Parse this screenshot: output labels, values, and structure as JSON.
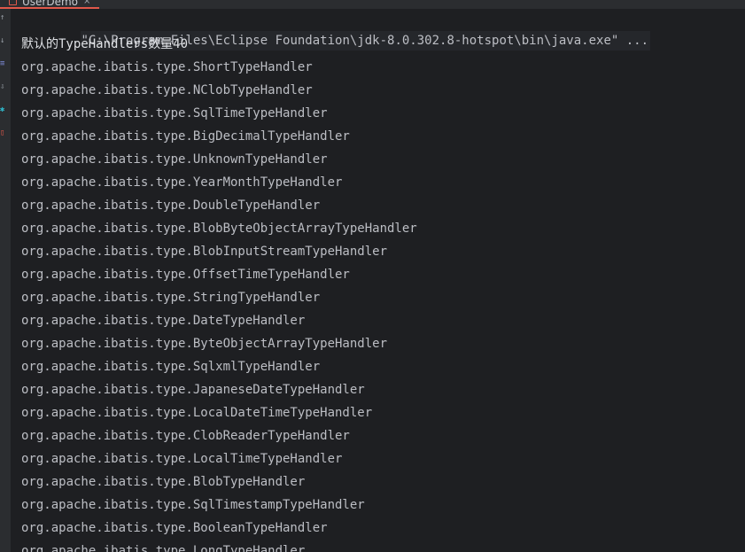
{
  "tab": {
    "label": "UserDemo",
    "close": "×",
    "accent": "#e0584a"
  },
  "gutter": {
    "icons": [
      {
        "name": "up-arrow-icon",
        "glyph": "↑",
        "color": "#9aa0a8"
      },
      {
        "name": "down-arrow-icon",
        "glyph": "↓",
        "color": "#9aa0a8"
      },
      {
        "name": "soft-wrap-icon",
        "glyph": "≡",
        "color": "#7f8bd8"
      },
      {
        "name": "scroll-end-icon",
        "glyph": "⇩",
        "color": "#9aa0a8"
      },
      {
        "name": "settings-icon",
        "glyph": "✱",
        "color": "#2fb5c8"
      },
      {
        "name": "trash-icon",
        "glyph": "▯",
        "color": "#e0584a"
      }
    ]
  },
  "console": {
    "command": "\"C:\\Program Files\\Eclipse Foundation\\jdk-8.0.302.8-hotspot\\bin\\java.exe\" ...",
    "count_line": "默认的TypeHandlers数量40",
    "handlers": [
      "org.apache.ibatis.type.ShortTypeHandler",
      "org.apache.ibatis.type.NClobTypeHandler",
      "org.apache.ibatis.type.SqlTimeTypeHandler",
      "org.apache.ibatis.type.BigDecimalTypeHandler",
      "org.apache.ibatis.type.UnknownTypeHandler",
      "org.apache.ibatis.type.YearMonthTypeHandler",
      "org.apache.ibatis.type.DoubleTypeHandler",
      "org.apache.ibatis.type.BlobByteObjectArrayTypeHandler",
      "org.apache.ibatis.type.BlobInputStreamTypeHandler",
      "org.apache.ibatis.type.OffsetTimeTypeHandler",
      "org.apache.ibatis.type.StringTypeHandler",
      "org.apache.ibatis.type.DateTypeHandler",
      "org.apache.ibatis.type.ByteObjectArrayTypeHandler",
      "org.apache.ibatis.type.SqlxmlTypeHandler",
      "org.apache.ibatis.type.JapaneseDateTypeHandler",
      "org.apache.ibatis.type.LocalDateTimeTypeHandler",
      "org.apache.ibatis.type.ClobReaderTypeHandler",
      "org.apache.ibatis.type.LocalTimeTypeHandler",
      "org.apache.ibatis.type.BlobTypeHandler",
      "org.apache.ibatis.type.SqlTimestampTypeHandler",
      "org.apache.ibatis.type.BooleanTypeHandler",
      "org.apache.ibatis.type.LongTypeHandler"
    ]
  }
}
